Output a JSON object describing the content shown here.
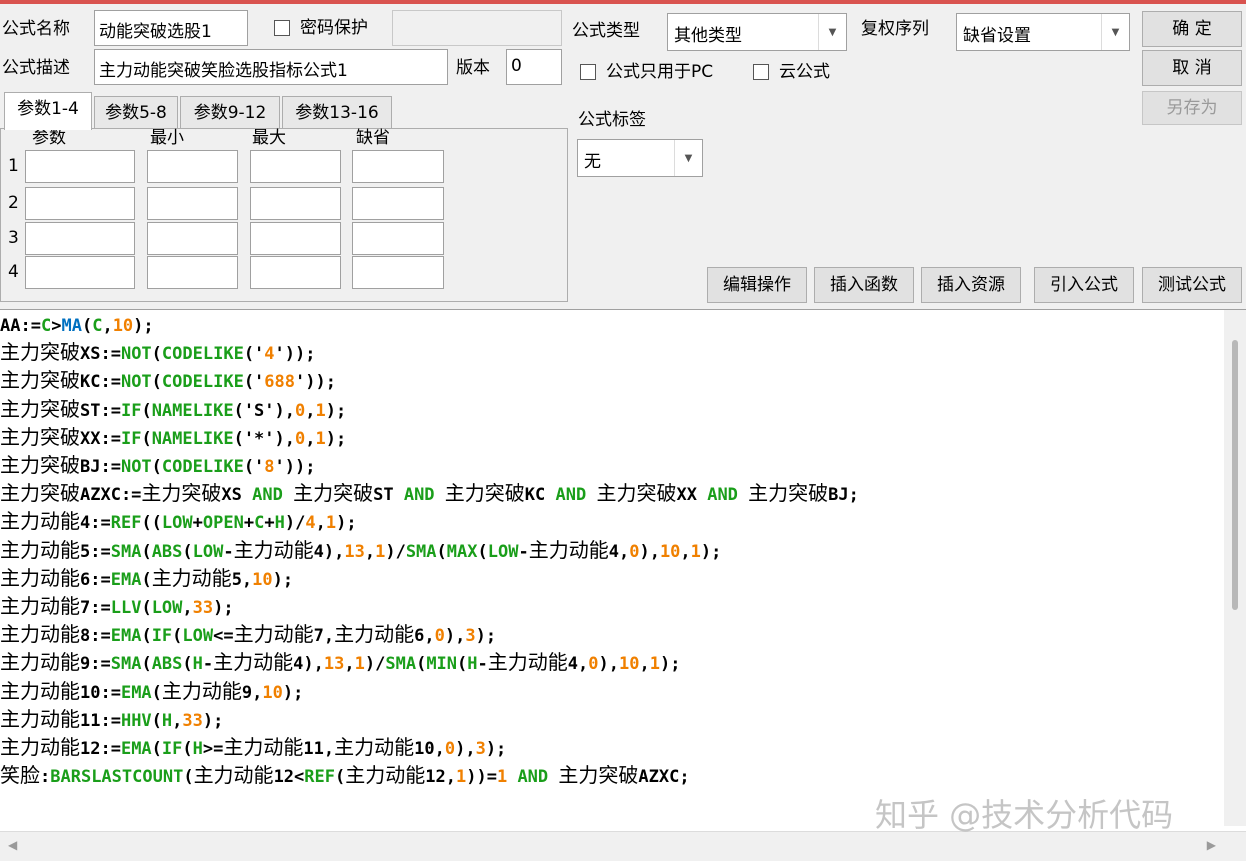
{
  "top": {
    "name_label": "公式名称",
    "name_value": "动能突破选股1",
    "password_label": "密码保护",
    "password_value": "",
    "desc_label": "公式描述",
    "desc_value": "主力动能突破笑脸选股指标公式1",
    "version_label": "版本",
    "version_value": "0",
    "type_label": "公式类型",
    "type_value": "其他类型",
    "rights_label": "复权序列",
    "rights_value": "缺省设置",
    "pc_only_label": "公式只用于PC",
    "cloud_label": "云公式",
    "tag_label": "公式标签",
    "tag_value": "无"
  },
  "buttons": {
    "ok": "确  定",
    "cancel": "取  消",
    "save_as": "另存为",
    "edit_ops": "编辑操作",
    "insert_func": "插入函数",
    "insert_res": "插入资源",
    "import": "引入公式",
    "test": "测试公式"
  },
  "tabs": [
    {
      "label": "参数1-4"
    },
    {
      "label": "参数5-8"
    },
    {
      "label": "参数9-12"
    },
    {
      "label": "参数13-16"
    }
  ],
  "params": {
    "headers": [
      "参数",
      "最小",
      "最大",
      "缺省"
    ],
    "rows": [
      "1",
      "2",
      "3",
      "4"
    ]
  },
  "code_lines": [
    [
      {
        "t": "AA:=",
        "c": "k"
      },
      {
        "t": "C",
        "c": "f"
      },
      {
        "t": ">",
        "c": "k"
      },
      {
        "t": "MA",
        "c": "b"
      },
      {
        "t": "(",
        "c": "k"
      },
      {
        "t": "C",
        "c": "f"
      },
      {
        "t": ",",
        "c": "k"
      },
      {
        "t": "10",
        "c": "n"
      },
      {
        "t": ");",
        "c": "k"
      }
    ],
    [
      {
        "t": "主力突破",
        "c": "cn"
      },
      {
        "t": "XS:=",
        "c": "k"
      },
      {
        "t": "NOT",
        "c": "f"
      },
      {
        "t": "(",
        "c": "k"
      },
      {
        "t": "CODELIKE",
        "c": "f"
      },
      {
        "t": "('",
        "c": "k"
      },
      {
        "t": "4",
        "c": "n"
      },
      {
        "t": "'));",
        "c": "k"
      }
    ],
    [
      {
        "t": "主力突破",
        "c": "cn"
      },
      {
        "t": "KC:=",
        "c": "k"
      },
      {
        "t": "NOT",
        "c": "f"
      },
      {
        "t": "(",
        "c": "k"
      },
      {
        "t": "CODELIKE",
        "c": "f"
      },
      {
        "t": "('",
        "c": "k"
      },
      {
        "t": "688",
        "c": "n"
      },
      {
        "t": "'));",
        "c": "k"
      }
    ],
    [
      {
        "t": "主力突破",
        "c": "cn"
      },
      {
        "t": "ST:=",
        "c": "k"
      },
      {
        "t": "IF",
        "c": "f"
      },
      {
        "t": "(",
        "c": "k"
      },
      {
        "t": "NAMELIKE",
        "c": "f"
      },
      {
        "t": "('S'),",
        "c": "k"
      },
      {
        "t": "0",
        "c": "n"
      },
      {
        "t": ",",
        "c": "k"
      },
      {
        "t": "1",
        "c": "n"
      },
      {
        "t": ");",
        "c": "k"
      }
    ],
    [
      {
        "t": "主力突破",
        "c": "cn"
      },
      {
        "t": "XX:=",
        "c": "k"
      },
      {
        "t": "IF",
        "c": "f"
      },
      {
        "t": "(",
        "c": "k"
      },
      {
        "t": "NAMELIKE",
        "c": "f"
      },
      {
        "t": "('*'),",
        "c": "k"
      },
      {
        "t": "0",
        "c": "n"
      },
      {
        "t": ",",
        "c": "k"
      },
      {
        "t": "1",
        "c": "n"
      },
      {
        "t": ");",
        "c": "k"
      }
    ],
    [
      {
        "t": "主力突破",
        "c": "cn"
      },
      {
        "t": "BJ:=",
        "c": "k"
      },
      {
        "t": "NOT",
        "c": "f"
      },
      {
        "t": "(",
        "c": "k"
      },
      {
        "t": "CODELIKE",
        "c": "f"
      },
      {
        "t": "('",
        "c": "k"
      },
      {
        "t": "8",
        "c": "n"
      },
      {
        "t": "'));",
        "c": "k"
      }
    ],
    [
      {
        "t": "主力突破",
        "c": "cn"
      },
      {
        "t": "AZXC:=",
        "c": "k"
      },
      {
        "t": "主力突破",
        "c": "cn"
      },
      {
        "t": "XS ",
        "c": "k"
      },
      {
        "t": "AND",
        "c": "f"
      },
      {
        "t": " ",
        "c": "k"
      },
      {
        "t": "主力突破",
        "c": "cn"
      },
      {
        "t": "ST ",
        "c": "k"
      },
      {
        "t": "AND",
        "c": "f"
      },
      {
        "t": " ",
        "c": "k"
      },
      {
        "t": "主力突破",
        "c": "cn"
      },
      {
        "t": "KC ",
        "c": "k"
      },
      {
        "t": "AND",
        "c": "f"
      },
      {
        "t": " ",
        "c": "k"
      },
      {
        "t": "主力突破",
        "c": "cn"
      },
      {
        "t": "XX ",
        "c": "k"
      },
      {
        "t": "AND",
        "c": "f"
      },
      {
        "t": " ",
        "c": "k"
      },
      {
        "t": "主力突破",
        "c": "cn"
      },
      {
        "t": "BJ;",
        "c": "k"
      }
    ],
    [
      {
        "t": "主力动能",
        "c": "cn"
      },
      {
        "t": "4:=",
        "c": "k"
      },
      {
        "t": "REF",
        "c": "f"
      },
      {
        "t": "((",
        "c": "k"
      },
      {
        "t": "LOW",
        "c": "f"
      },
      {
        "t": "+",
        "c": "k"
      },
      {
        "t": "OPEN",
        "c": "f"
      },
      {
        "t": "+",
        "c": "k"
      },
      {
        "t": "C",
        "c": "f"
      },
      {
        "t": "+",
        "c": "k"
      },
      {
        "t": "H",
        "c": "f"
      },
      {
        "t": ")/",
        "c": "k"
      },
      {
        "t": "4",
        "c": "n"
      },
      {
        "t": ",",
        "c": "k"
      },
      {
        "t": "1",
        "c": "n"
      },
      {
        "t": ");",
        "c": "k"
      }
    ],
    [
      {
        "t": "主力动能",
        "c": "cn"
      },
      {
        "t": "5:=",
        "c": "k"
      },
      {
        "t": "SMA",
        "c": "f"
      },
      {
        "t": "(",
        "c": "k"
      },
      {
        "t": "ABS",
        "c": "f"
      },
      {
        "t": "(",
        "c": "k"
      },
      {
        "t": "LOW",
        "c": "f"
      },
      {
        "t": "-",
        "c": "k"
      },
      {
        "t": "主力动能",
        "c": "cn"
      },
      {
        "t": "4),",
        "c": "k"
      },
      {
        "t": "13",
        "c": "n"
      },
      {
        "t": ",",
        "c": "k"
      },
      {
        "t": "1",
        "c": "n"
      },
      {
        "t": ")/",
        "c": "k"
      },
      {
        "t": "SMA",
        "c": "f"
      },
      {
        "t": "(",
        "c": "k"
      },
      {
        "t": "MAX",
        "c": "f"
      },
      {
        "t": "(",
        "c": "k"
      },
      {
        "t": "LOW",
        "c": "f"
      },
      {
        "t": "-",
        "c": "k"
      },
      {
        "t": "主力动能",
        "c": "cn"
      },
      {
        "t": "4,",
        "c": "k"
      },
      {
        "t": "0",
        "c": "n"
      },
      {
        "t": "),",
        "c": "k"
      },
      {
        "t": "10",
        "c": "n"
      },
      {
        "t": ",",
        "c": "k"
      },
      {
        "t": "1",
        "c": "n"
      },
      {
        "t": ");",
        "c": "k"
      }
    ],
    [
      {
        "t": "主力动能",
        "c": "cn"
      },
      {
        "t": "6:=",
        "c": "k"
      },
      {
        "t": "EMA",
        "c": "f"
      },
      {
        "t": "(",
        "c": "k"
      },
      {
        "t": "主力动能",
        "c": "cn"
      },
      {
        "t": "5,",
        "c": "k"
      },
      {
        "t": "10",
        "c": "n"
      },
      {
        "t": ");",
        "c": "k"
      }
    ],
    [
      {
        "t": "主力动能",
        "c": "cn"
      },
      {
        "t": "7:=",
        "c": "k"
      },
      {
        "t": "LLV",
        "c": "f"
      },
      {
        "t": "(",
        "c": "k"
      },
      {
        "t": "LOW",
        "c": "f"
      },
      {
        "t": ",",
        "c": "k"
      },
      {
        "t": "33",
        "c": "n"
      },
      {
        "t": ");",
        "c": "k"
      }
    ],
    [
      {
        "t": "主力动能",
        "c": "cn"
      },
      {
        "t": "8:=",
        "c": "k"
      },
      {
        "t": "EMA",
        "c": "f"
      },
      {
        "t": "(",
        "c": "k"
      },
      {
        "t": "IF",
        "c": "f"
      },
      {
        "t": "(",
        "c": "k"
      },
      {
        "t": "LOW",
        "c": "f"
      },
      {
        "t": "<=",
        "c": "k"
      },
      {
        "t": "主力动能",
        "c": "cn"
      },
      {
        "t": "7,",
        "c": "k"
      },
      {
        "t": "主力动能",
        "c": "cn"
      },
      {
        "t": "6,",
        "c": "k"
      },
      {
        "t": "0",
        "c": "n"
      },
      {
        "t": "),",
        "c": "k"
      },
      {
        "t": "3",
        "c": "n"
      },
      {
        "t": ");",
        "c": "k"
      }
    ],
    [
      {
        "t": "主力动能",
        "c": "cn"
      },
      {
        "t": "9:=",
        "c": "k"
      },
      {
        "t": "SMA",
        "c": "f"
      },
      {
        "t": "(",
        "c": "k"
      },
      {
        "t": "ABS",
        "c": "f"
      },
      {
        "t": "(",
        "c": "k"
      },
      {
        "t": "H",
        "c": "f"
      },
      {
        "t": "-",
        "c": "k"
      },
      {
        "t": "主力动能",
        "c": "cn"
      },
      {
        "t": "4),",
        "c": "k"
      },
      {
        "t": "13",
        "c": "n"
      },
      {
        "t": ",",
        "c": "k"
      },
      {
        "t": "1",
        "c": "n"
      },
      {
        "t": ")/",
        "c": "k"
      },
      {
        "t": "SMA",
        "c": "f"
      },
      {
        "t": "(",
        "c": "k"
      },
      {
        "t": "MIN",
        "c": "f"
      },
      {
        "t": "(",
        "c": "k"
      },
      {
        "t": "H",
        "c": "f"
      },
      {
        "t": "-",
        "c": "k"
      },
      {
        "t": "主力动能",
        "c": "cn"
      },
      {
        "t": "4,",
        "c": "k"
      },
      {
        "t": "0",
        "c": "n"
      },
      {
        "t": "),",
        "c": "k"
      },
      {
        "t": "10",
        "c": "n"
      },
      {
        "t": ",",
        "c": "k"
      },
      {
        "t": "1",
        "c": "n"
      },
      {
        "t": ");",
        "c": "k"
      }
    ],
    [
      {
        "t": "主力动能",
        "c": "cn"
      },
      {
        "t": "10:=",
        "c": "k"
      },
      {
        "t": "EMA",
        "c": "f"
      },
      {
        "t": "(",
        "c": "k"
      },
      {
        "t": "主力动能",
        "c": "cn"
      },
      {
        "t": "9,",
        "c": "k"
      },
      {
        "t": "10",
        "c": "n"
      },
      {
        "t": ");",
        "c": "k"
      }
    ],
    [
      {
        "t": "主力动能",
        "c": "cn"
      },
      {
        "t": "11:=",
        "c": "k"
      },
      {
        "t": "HHV",
        "c": "f"
      },
      {
        "t": "(",
        "c": "k"
      },
      {
        "t": "H",
        "c": "f"
      },
      {
        "t": ",",
        "c": "k"
      },
      {
        "t": "33",
        "c": "n"
      },
      {
        "t": ");",
        "c": "k"
      }
    ],
    [
      {
        "t": "主力动能",
        "c": "cn"
      },
      {
        "t": "12:=",
        "c": "k"
      },
      {
        "t": "EMA",
        "c": "f"
      },
      {
        "t": "(",
        "c": "k"
      },
      {
        "t": "IF",
        "c": "f"
      },
      {
        "t": "(",
        "c": "k"
      },
      {
        "t": "H",
        "c": "f"
      },
      {
        "t": ">=",
        "c": "k"
      },
      {
        "t": "主力动能",
        "c": "cn"
      },
      {
        "t": "11,",
        "c": "k"
      },
      {
        "t": "主力动能",
        "c": "cn"
      },
      {
        "t": "10,",
        "c": "k"
      },
      {
        "t": "0",
        "c": "n"
      },
      {
        "t": "),",
        "c": "k"
      },
      {
        "t": "3",
        "c": "n"
      },
      {
        "t": ");",
        "c": "k"
      }
    ],
    [
      {
        "t": "笑脸",
        "c": "cn"
      },
      {
        "t": ":",
        "c": "k"
      },
      {
        "t": "BARSLASTCOUNT",
        "c": "f"
      },
      {
        "t": "(",
        "c": "k"
      },
      {
        "t": "主力动能",
        "c": "cn"
      },
      {
        "t": "12<",
        "c": "k"
      },
      {
        "t": "REF",
        "c": "f"
      },
      {
        "t": "(",
        "c": "k"
      },
      {
        "t": "主力动能",
        "c": "cn"
      },
      {
        "t": "12,",
        "c": "k"
      },
      {
        "t": "1",
        "c": "n"
      },
      {
        "t": "))=",
        "c": "k"
      },
      {
        "t": "1",
        "c": "n"
      },
      {
        "t": " ",
        "c": "k"
      },
      {
        "t": "AND",
        "c": "f"
      },
      {
        "t": " ",
        "c": "k"
      },
      {
        "t": "主力突破",
        "c": "cn"
      },
      {
        "t": "AZXC;",
        "c": "k"
      }
    ]
  ],
  "watermark": "知乎 @技术分析代码",
  "colors": {
    "function_green": "#1a9e1a",
    "number_orange": "#f08000",
    "ma_blue": "#0070c0",
    "accent_red": "#d9534f"
  }
}
